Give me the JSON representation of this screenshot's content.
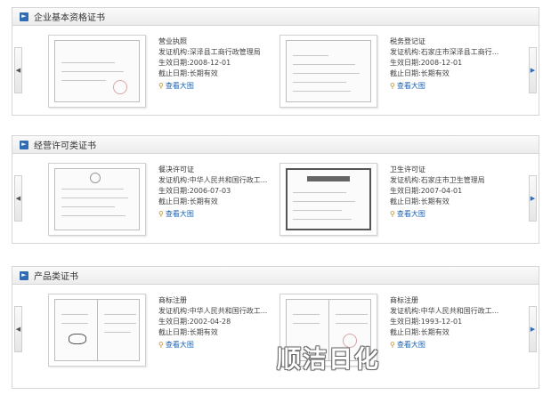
{
  "sections": [
    {
      "title": "企业基本资格证书",
      "certs": [
        {
          "name": "营业执照",
          "issuer_label": "发证机构:",
          "issuer": "深泽县工商行政管理局",
          "start_label": "生效日期:",
          "start": "2008-12-01",
          "end_label": "截止日期:",
          "end": "长期有效",
          "view": "查看大图"
        },
        {
          "name": "税务登记证",
          "issuer_label": "发证机构:",
          "issuer": "石家庄市深泽县工商行...",
          "start_label": "生效日期:",
          "start": "2008-12-01",
          "end_label": "截止日期:",
          "end": "长期有效",
          "view": "查看大图"
        }
      ]
    },
    {
      "title": "经营许可类证书",
      "certs": [
        {
          "name": "餐决许可证",
          "issuer_label": "发证机构:",
          "issuer": "中华人民共和国行政工...",
          "start_label": "生效日期:",
          "start": "2006-07-03",
          "end_label": "截止日期:",
          "end": "长期有效",
          "view": "查看大图"
        },
        {
          "name": "卫生许可证",
          "issuer_label": "发证机构:",
          "issuer": "石家庄市卫生管理局",
          "start_label": "生效日期:",
          "start": "2007-04-01",
          "end_label": "截止日期:",
          "end": "长期有效",
          "view": "查看大图"
        }
      ]
    },
    {
      "title": "产品类证书",
      "certs": [
        {
          "name": "商标注册",
          "issuer_label": "发证机构:",
          "issuer": "中华人民共和国行政工...",
          "start_label": "生效日期:",
          "start": "2002-04-28",
          "end_label": "截止日期:",
          "end": "长期有效",
          "view": "查看大图"
        },
        {
          "name": "商标注册",
          "issuer_label": "发证机构:",
          "issuer": "中华人民共和国行政工...",
          "start_label": "生效日期:",
          "start": "1993-12-01",
          "end_label": "截止日期:",
          "end": "长期有效",
          "view": "查看大图"
        }
      ]
    }
  ],
  "icons": {
    "section": "chevron-right-icon",
    "prev": "chevron-left-icon",
    "next": "chevron-right-icon",
    "view": "magnifier-icon"
  },
  "colors": {
    "accent": "#2f6cb3",
    "link": "#1a5fb0"
  },
  "watermark": "顺洁日化"
}
